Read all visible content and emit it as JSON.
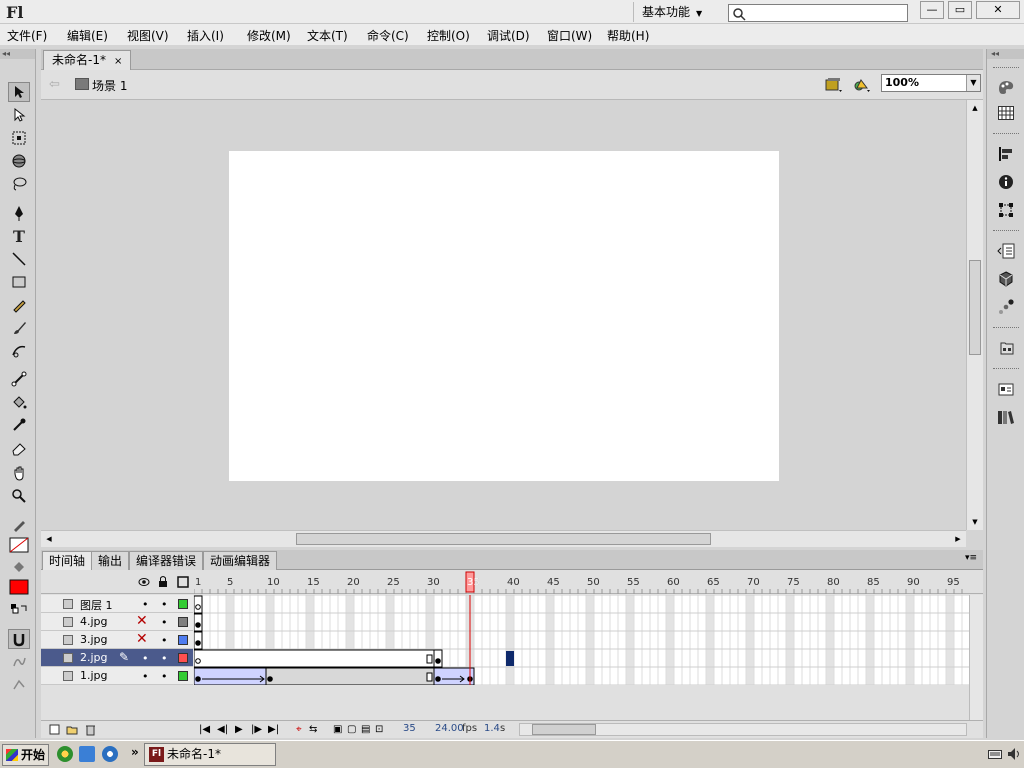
{
  "app": {
    "logo": "Fl",
    "workspace": "基本功能",
    "search_placeholder": "",
    "window_buttons": [
      "—",
      "▭",
      "✕"
    ]
  },
  "menu": [
    "文件(F)",
    "编辑(E)",
    "视图(V)",
    "插入(I)",
    "修改(M)",
    "文本(T)",
    "命令(C)",
    "控制(O)",
    "调试(D)",
    "窗口(W)",
    "帮助(H)"
  ],
  "document": {
    "tab_label": "未命名-1*",
    "tab_close": "×",
    "scene_label": "场景 1",
    "zoom": "100%"
  },
  "tools": [
    "selection-tool",
    "subselection-tool",
    "free-transform-tool",
    "3d-rotation-tool",
    "lasso-tool",
    "pen-tool",
    "text-tool",
    "line-tool",
    "rectangle-tool",
    "pencil-tool",
    "brush-tool",
    "deco-tool",
    "bone-tool",
    "paint-bucket-tool",
    "eyedropper-tool",
    "eraser-tool",
    "hand-tool",
    "zoom-tool",
    "stroke-color",
    "fill-color",
    "black-white",
    "swap-colors",
    "snap-to-objects",
    "smooth",
    "straighten"
  ],
  "tool_colors": {
    "stroke": "#000000",
    "fill": "#ff0000"
  },
  "timeline_tabs": [
    "时间轴",
    "输出",
    "编译器错误",
    "动画编辑器"
  ],
  "timeline": {
    "frame_numbers": [
      "1",
      "5",
      "10",
      "15",
      "20",
      "25",
      "30",
      "35",
      "40",
      "45",
      "50",
      "55",
      "60",
      "65",
      "70",
      "75",
      "80",
      "85",
      "90",
      "95"
    ],
    "current_frame": "35",
    "fps": "24.00",
    "fps_unit": "fps",
    "time": "1.4",
    "time_unit": "s",
    "layers": [
      {
        "name": "图层 1",
        "hidden": false,
        "color": "#33cc33",
        "selected": false
      },
      {
        "name": "4.jpg",
        "hidden": true,
        "color": "#808080",
        "selected": false
      },
      {
        "name": "3.jpg",
        "hidden": true,
        "color": "#4f7cf0",
        "selected": false
      },
      {
        "name": "2.jpg",
        "hidden": false,
        "color": "#ff4f4f",
        "selected": true
      },
      {
        "name": "1.jpg",
        "hidden": false,
        "color": "#33cc33",
        "selected": false
      }
    ]
  },
  "taskbar": {
    "start_label": "开始",
    "task_label": "未命名-1*",
    "more": "»"
  }
}
